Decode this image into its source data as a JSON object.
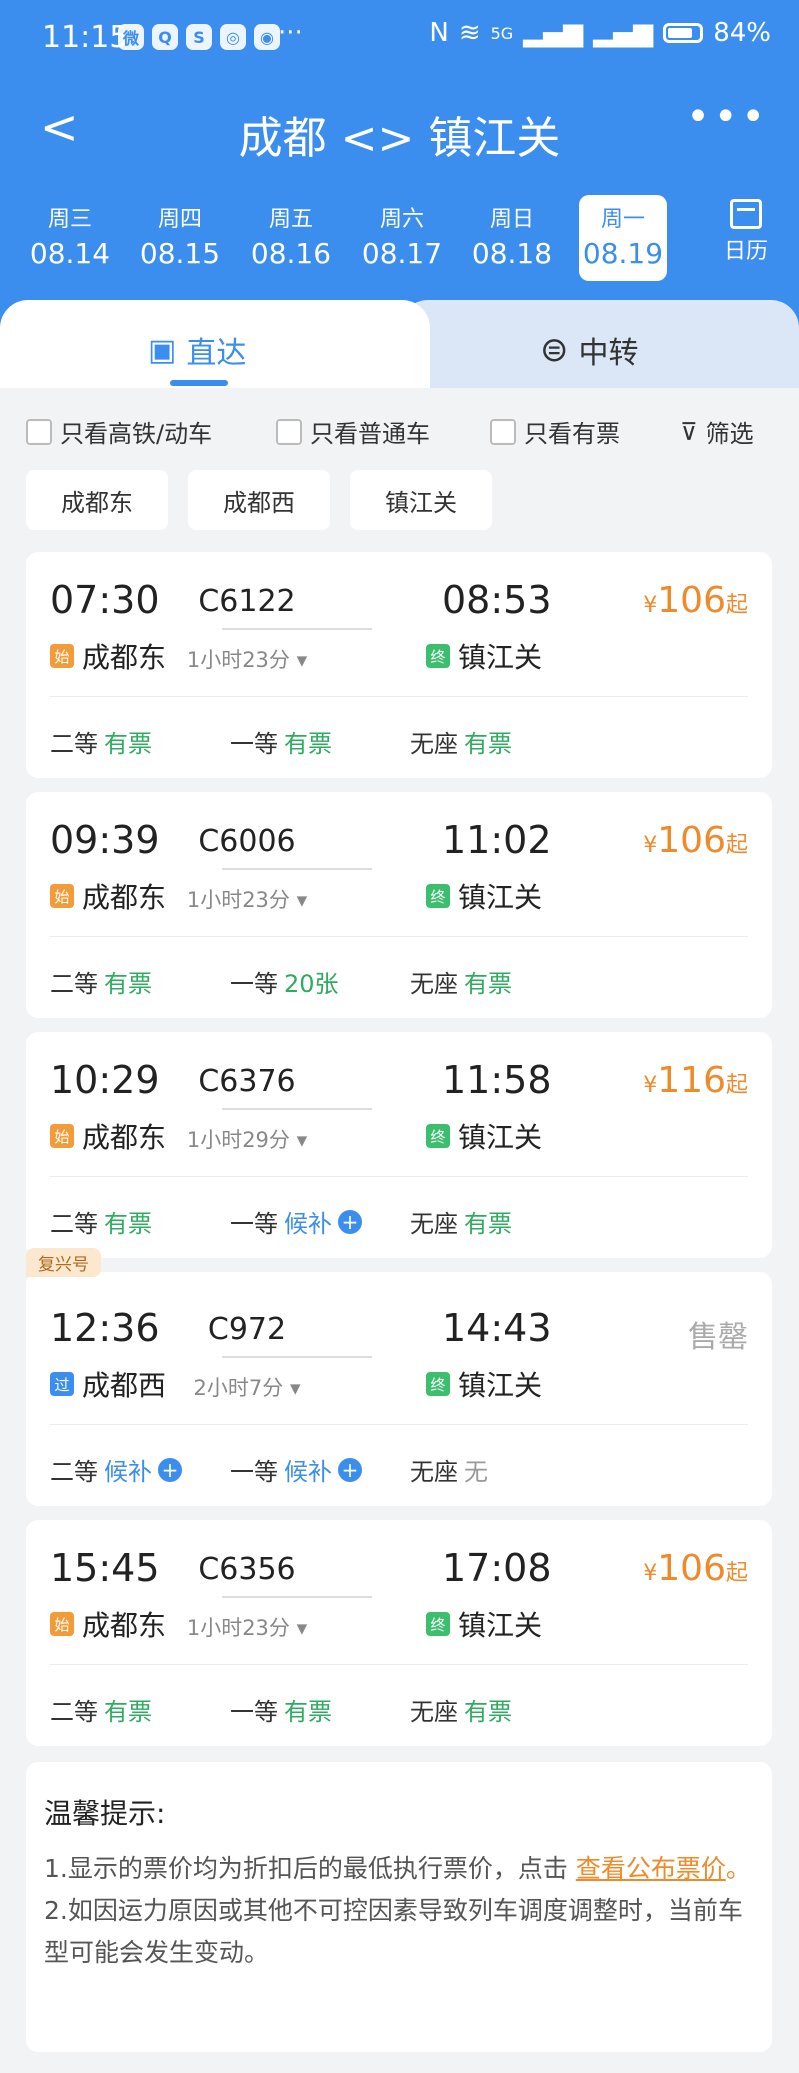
{
  "status_bar": {
    "time": "11:15",
    "apps": [
      "微",
      "Q",
      "S",
      "◎",
      "◉"
    ],
    "more": "···",
    "network": "5G",
    "battery": "84%"
  },
  "header": {
    "back": "<",
    "title": "成都 <> 镇江关",
    "more": "•••"
  },
  "dates": [
    {
      "weekday": "周三",
      "date": "08.14"
    },
    {
      "weekday": "周四",
      "date": "08.15"
    },
    {
      "weekday": "周五",
      "date": "08.16"
    },
    {
      "weekday": "周六",
      "date": "08.17"
    },
    {
      "weekday": "周日",
      "date": "08.18"
    },
    {
      "weekday": "周一",
      "date": "08.19"
    }
  ],
  "calendar_label": "日历",
  "tabs": {
    "direct": "直达",
    "transfer": "中转"
  },
  "filters": {
    "hs": "只看高铁/动车",
    "normal": "只看普通车",
    "avail": "只看有票",
    "screen": "筛选"
  },
  "stations": [
    "成都东",
    "成都西",
    "镇江关"
  ],
  "trains": [
    {
      "dep_time": "07:30",
      "dep_tag": "始",
      "dep_station": "成都东",
      "train_no": "C6122",
      "duration": "1小时23分",
      "arr_time": "08:53",
      "arr_tag": "终",
      "arr_station": "镇江关",
      "yen": "¥",
      "price": "106",
      "qi": "起",
      "seats": [
        {
          "name": "二等",
          "status": "有票"
        },
        {
          "name": "一等",
          "status": "有票"
        },
        {
          "name": "无座",
          "status": "有票"
        }
      ]
    },
    {
      "dep_time": "09:39",
      "dep_tag": "始",
      "dep_station": "成都东",
      "train_no": "C6006",
      "duration": "1小时23分",
      "arr_time": "11:02",
      "arr_tag": "终",
      "arr_station": "镇江关",
      "yen": "¥",
      "price": "106",
      "qi": "起",
      "seats": [
        {
          "name": "二等",
          "status": "有票"
        },
        {
          "name": "一等",
          "status": "20张"
        },
        {
          "name": "无座",
          "status": "有票"
        }
      ]
    },
    {
      "dep_time": "10:29",
      "dep_tag": "始",
      "dep_station": "成都东",
      "train_no": "C6376",
      "duration": "1小时29分",
      "arr_time": "11:58",
      "arr_tag": "终",
      "arr_station": "镇江关",
      "yen": "¥",
      "price": "116",
      "qi": "起",
      "seats": [
        {
          "name": "二等",
          "status": "有票"
        },
        {
          "name": "一等",
          "status": "候补"
        },
        {
          "name": "无座",
          "status": "有票"
        }
      ]
    },
    {
      "badge": "复兴号",
      "dep_time": "12:36",
      "dep_tag": "过",
      "dep_station": "成都西",
      "train_no": "C972",
      "duration": "2小时7分",
      "arr_time": "14:43",
      "arr_tag": "终",
      "arr_station": "镇江关",
      "soldout": "售罄",
      "seats": [
        {
          "name": "二等",
          "status": "候补"
        },
        {
          "name": "一等",
          "status": "候补"
        },
        {
          "name": "无座",
          "status": "无"
        }
      ]
    },
    {
      "dep_time": "15:45",
      "dep_tag": "始",
      "dep_station": "成都东",
      "train_no": "C6356",
      "duration": "1小时23分",
      "arr_time": "17:08",
      "arr_tag": "终",
      "arr_station": "镇江关",
      "yen": "¥",
      "price": "106",
      "qi": "起",
      "seats": [
        {
          "name": "二等",
          "status": "有票"
        },
        {
          "name": "一等",
          "status": "有票"
        },
        {
          "name": "无座",
          "status": "有票"
        }
      ]
    }
  ],
  "tips": {
    "title": "温馨提示:",
    "line1_pre": "1.显示的票价均为折扣后的最低执行票价，点击 ",
    "line1_link": "查看公布票价",
    "line1_post": "。",
    "line2": "2.如因运力原因或其他不可控因素导致列车调度调整时，当前车型可能会发生变动。"
  },
  "colors": {
    "primary": "#3c8eee",
    "price": "#ef8a2a",
    "available": "#2eab5f"
  }
}
